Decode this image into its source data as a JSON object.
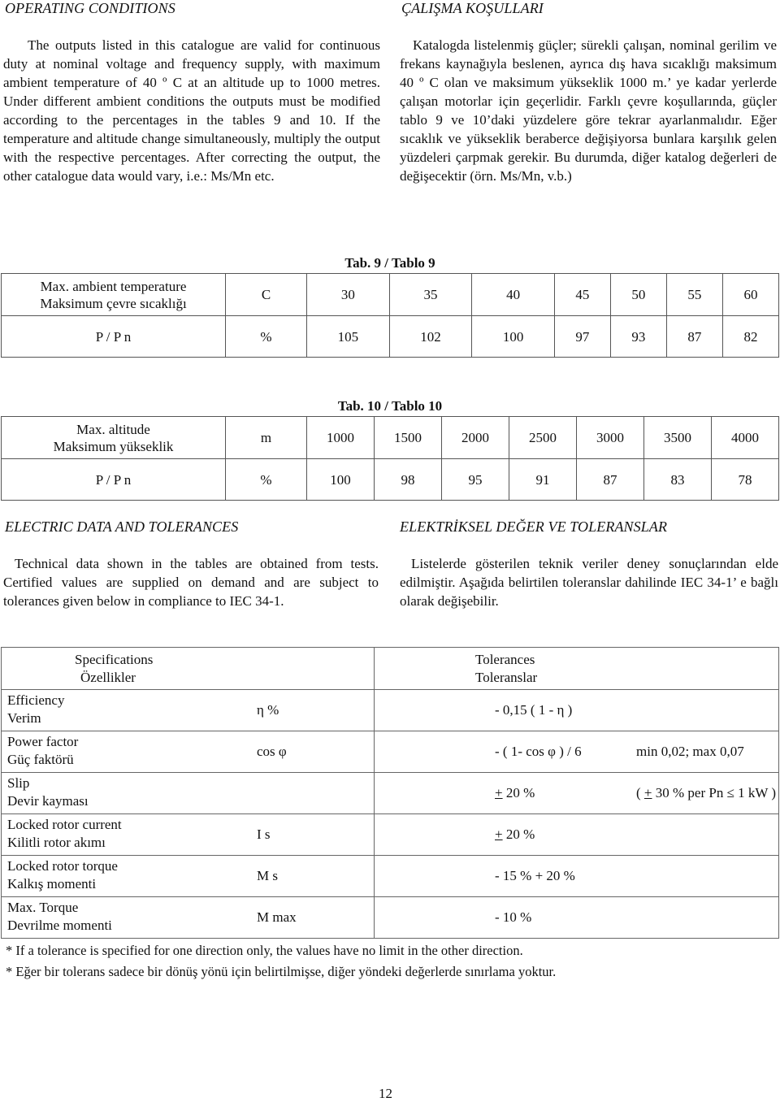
{
  "operating_conditions": {
    "en_heading": "OPERATING CONDITIONS",
    "en_paragraph": "The outputs listed in this catalogue are valid for continuous duty at nominal voltage and frequency supply, with maximum ambient temperature of 40 º C at an altitude up to 1000 metres. Under different ambient conditions the outputs must be modified according to the percentages in the tables 9 and 10. If the temperature and altitude change simultaneously, multiply the output with the respective percentages. After correcting the output, the other catalogue data would vary, i.e.: Ms/Mn etc.",
    "tr_heading": "ÇALIŞMA KOŞULLARI",
    "tr_paragraph": "Katalogda listelenmiş güçler; sürekli çalışan, nominal gerilim ve frekans kaynağıyla beslenen, ayrıca dış hava sıcaklığı maksimum 40 º C olan ve maksimum yükseklik 1000 m.’ ye kadar yerlerde çalışan motorlar için geçerlidir. Farklı çevre koşullarında, güçler tablo 9 ve 10’daki yüzdelere göre tekrar ayarlanmalıdır. Eğer sıcaklık ve yükseklik beraberce değişiyorsa bunlara karşılık gelen yüzdeleri çarpmak gerekir. Bu durumda, diğer katalog değerleri de değişecektir (örn. Ms/Mn, v.b.)"
  },
  "table9": {
    "caption": "Tab. 9 / Tablo 9",
    "row1_label_en": "Max. ambient temperature",
    "row1_label_tr": "Maksimum çevre sıcaklığı",
    "row1_unit": "C",
    "row1_values": [
      "30",
      "35",
      "40",
      "45",
      "50",
      "55",
      "60"
    ],
    "row2_label": "P / P n",
    "row2_unit": "%",
    "row2_values": [
      "105",
      "102",
      "100",
      "97",
      "93",
      "87",
      "82"
    ]
  },
  "table10": {
    "caption": "Tab. 10 / Tablo 10",
    "row1_label_en": "Max. altitude",
    "row1_label_tr": "Maksimum yükseklik",
    "row1_unit": "m",
    "row1_values": [
      "1000",
      "1500",
      "2000",
      "2500",
      "3000",
      "3500",
      "4000"
    ],
    "row2_label": "P / P n",
    "row2_unit": "%",
    "row2_values": [
      "100",
      "98",
      "95",
      "91",
      "87",
      "83",
      "78"
    ]
  },
  "electric_data": {
    "en_heading": "ELECTRIC DATA AND TOLERANCES",
    "en_paragraph": "Technical data shown in the tables are obtained from tests. Certified values are supplied on demand and are subject to tolerances given below in compliance to IEC 34-1.",
    "tr_heading": "ELEKTRİKSEL DEĞER VE TOLERANSLAR",
    "tr_paragraph": "Listelerde gösterilen teknik veriler deney sonuçlarından elde edilmiştir. Aşağıda belirtilen toleranslar dahilinde IEC 34-1’ e bağlı olarak değişebilir."
  },
  "tolerance_table": {
    "header_spec_en": "Specifications",
    "header_spec_tr": "Özellikler",
    "header_tol_en": "Tolerances",
    "header_tol_tr": "Toleranslar",
    "rows": [
      {
        "en": "Efficiency",
        "tr": "Verim",
        "symbol": "η %",
        "tol_pm": "",
        "tol": "- 0,15 ( 1 - η )",
        "extra_pre": "",
        "extra_pm": "",
        "extra": ""
      },
      {
        "en": "Power factor",
        "tr": "Güç faktörü",
        "symbol": "cos  φ",
        "tol_pm": "",
        "tol": "- ( 1- cos φ ) / 6",
        "extra_pre": "",
        "extra_pm": "",
        "extra": "min 0,02; max 0,07"
      },
      {
        "en": "Slip",
        "tr": "Devir kayması",
        "symbol": "",
        "tol_pm": "+",
        "tol": " 20 %",
        "extra_pre": "( ",
        "extra_pm": "+",
        "extra": " 30 % per Pn ≤  1 kW )"
      },
      {
        "en": "Locked rotor current",
        "tr": "Kilitli rotor akımı",
        "symbol": "I s",
        "tol_pm": "+",
        "tol": " 20 %",
        "extra_pre": "",
        "extra_pm": "",
        "extra": ""
      },
      {
        "en": "Locked rotor torque",
        "tr": "Kalkış momenti",
        "symbol": "M s",
        "tol_pm": "",
        "tol": "- 15 % + 20 %",
        "extra_pre": "",
        "extra_pm": "",
        "extra": ""
      },
      {
        "en": "Max. Torque",
        "tr": "Devrilme momenti",
        "symbol": "M max",
        "tol_pm": "",
        "tol": "- 10 %",
        "extra_pre": "",
        "extra_pm": "",
        "extra": ""
      }
    ],
    "note_en": "* If a tolerance is specified for one direction only, the values have no limit in the other direction.",
    "note_tr": "* Eğer bir tolerans sadece bir dönüş yönü için belirtilmişse, diğer yöndeki değerlerde sınırlama yoktur."
  },
  "page_number": "12"
}
